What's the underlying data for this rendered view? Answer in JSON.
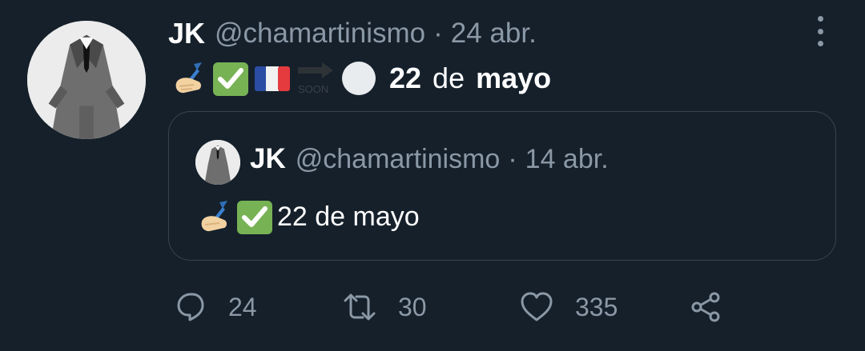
{
  "tweet": {
    "author_name": "JK",
    "handle": "@chamartinismo",
    "separator": "·",
    "date": "24 abr.",
    "text_day": "22",
    "text_de": "de",
    "text_month": "mayo",
    "soon_label": "SOON"
  },
  "quoted_tweet": {
    "author_name": "JK",
    "handle": "@chamartinismo",
    "separator": "·",
    "date": "14 abr.",
    "text": "22 de mayo"
  },
  "actions": {
    "replies": "24",
    "retweets": "30",
    "likes": "335"
  },
  "icons": [
    "writing-hand-icon",
    "check-mark-icon",
    "france-flag-icon",
    "soon-arrow-icon",
    "white-circle-icon",
    "reply-icon",
    "retweet-icon",
    "like-icon",
    "share-icon",
    "more-options-icon"
  ],
  "colors": {
    "background": "#15202b",
    "secondary_text": "#8b98a5",
    "border": "#38444d",
    "check_green": "#77b255"
  }
}
